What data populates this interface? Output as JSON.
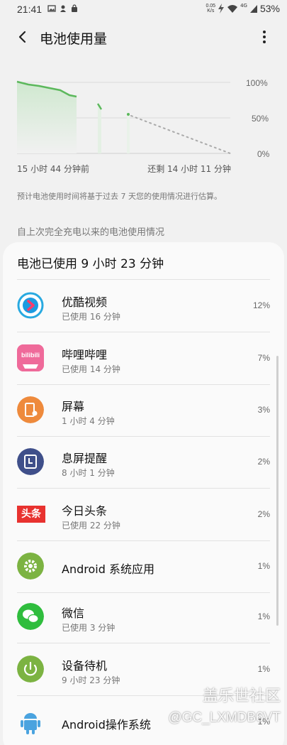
{
  "status_bar": {
    "time": "21:41",
    "speed_value": "0.05",
    "speed_unit": "K/s",
    "network": "4G",
    "battery": "53%"
  },
  "appbar": {
    "title": "电池使用量",
    "back_icon": "back-arrow-icon",
    "more_icon": "more-vert-icon"
  },
  "chart": {
    "y_labels": [
      "100%",
      "50%",
      "0%"
    ],
    "start_label": "15 小时 44 分钟前",
    "end_label": "还剩 14 小时 11 分钟",
    "line_color": "#5cb85c"
  },
  "note": "预计电池使用时间将基于过去 7 天您的使用情况进行估算。",
  "section_header": "自上次完全充电以来的电池使用情况",
  "card": {
    "title": "电池已使用 9 小时 23 分钟",
    "items": [
      {
        "name": "优酷视频",
        "sub": "已使用 16 分钟",
        "pct": "12%",
        "icon": "youku-icon"
      },
      {
        "name": "哔哩哔哩",
        "sub": "已使用 14 分钟",
        "pct": "7%",
        "icon": "bilibili-icon",
        "icon_text": "bilibili"
      },
      {
        "name": "屏幕",
        "sub": "1 小时 4 分钟",
        "pct": "3%",
        "icon": "screen-icon"
      },
      {
        "name": "息屏提醒",
        "sub": "8 小时 1 分钟",
        "pct": "2%",
        "icon": "always-on-display-icon"
      },
      {
        "name": "今日头条",
        "sub": "已使用 22 分钟",
        "pct": "2%",
        "icon": "toutiao-icon",
        "icon_text": "头条"
      },
      {
        "name": "Android 系统应用",
        "sub": "",
        "pct": "1%",
        "icon": "android-system-gear-icon"
      },
      {
        "name": "微信",
        "sub": "已使用 3 分钟",
        "pct": "1%",
        "icon": "wechat-icon"
      },
      {
        "name": "设备待机",
        "sub": "9 小时 23 分钟",
        "pct": "1%",
        "icon": "standby-power-icon"
      },
      {
        "name": "Android操作系统",
        "sub": "",
        "pct": "1%",
        "icon": "android-robot-icon"
      }
    ]
  },
  "watermark": {
    "line1": "盖乐世社区",
    "line2": "@GC_LXMDB6VT"
  }
}
